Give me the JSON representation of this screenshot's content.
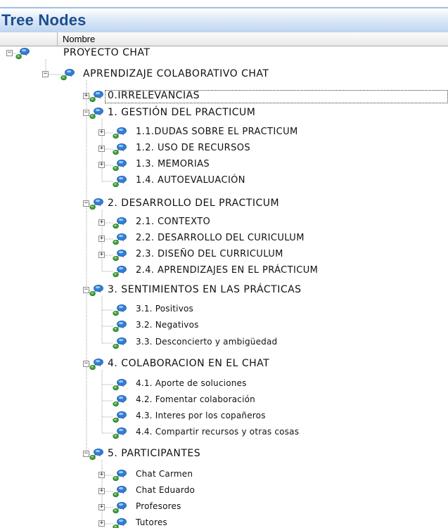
{
  "panel": {
    "title": "Tree Nodes",
    "column_header": "Nombre"
  },
  "icons": {
    "node": "node-network-icon",
    "expanded": "minus-toggle",
    "collapsed": "plus-toggle"
  },
  "colors": {
    "title": "#1c4e8c",
    "icon_blue": "#2f7fd6",
    "icon_green": "#3fa23c"
  },
  "tree": [
    {
      "label": "PROYECTO CHAT",
      "depth": 0,
      "toggle": "expanded"
    },
    {
      "label": "APRENDIZAJE COLABORATIVO CHAT",
      "depth": 1,
      "toggle": "expanded"
    },
    {
      "label": "0.IRRELEVANCIAS",
      "depth": 2,
      "toggle": "collapsed",
      "focused": true
    },
    {
      "label": "1. GESTIÓN DEL PRACTICUM",
      "depth": 2,
      "toggle": "expanded"
    },
    {
      "label": "1.1.DUDAS SOBRE EL PRACTICUM",
      "depth": 3,
      "toggle": "collapsed"
    },
    {
      "label": "1.2. USO DE RECURSOS",
      "depth": 3,
      "toggle": "collapsed"
    },
    {
      "label": "1.3. MEMORIAS",
      "depth": 3,
      "toggle": "collapsed"
    },
    {
      "label": "1.4. AUTOEVALUACIÓN",
      "depth": 3,
      "toggle": "none"
    },
    {
      "label": "2. DESARROLLO DEL PRACTICUM",
      "depth": 2,
      "toggle": "expanded"
    },
    {
      "label": "2.1. CONTEXTO",
      "depth": 3,
      "toggle": "collapsed"
    },
    {
      "label": "2.2. DESARROLLO DEL CURICULUM",
      "depth": 3,
      "toggle": "collapsed"
    },
    {
      "label": "2.3. DISEÑO DEL CURRICULUM",
      "depth": 3,
      "toggle": "collapsed"
    },
    {
      "label": "2.4. APRENDIZAJES EN EL PRÁCTICUM",
      "depth": 3,
      "toggle": "none"
    },
    {
      "label": "3. SENTIMIENTOS EN LAS PRÁCTICAS",
      "depth": 2,
      "toggle": "expanded"
    },
    {
      "label": "3.1. Positivos",
      "depth": 3,
      "toggle": "none"
    },
    {
      "label": "3.2. Negativos",
      "depth": 3,
      "toggle": "none"
    },
    {
      "label": "3.3. Desconcierto y ambigüedad",
      "depth": 3,
      "toggle": "none"
    },
    {
      "label": "4. COLABORACION EN EL CHAT",
      "depth": 2,
      "toggle": "expanded"
    },
    {
      "label": "4.1. Aporte de soluciones",
      "depth": 3,
      "toggle": "none"
    },
    {
      "label": "4.2. Fomentar colaboración",
      "depth": 3,
      "toggle": "none"
    },
    {
      "label": "4.3. Interes por los copañeros",
      "depth": 3,
      "toggle": "none"
    },
    {
      "label": "4.4. Compartir recursos y otras cosas",
      "depth": 3,
      "toggle": "none"
    },
    {
      "label": "5. PARTICIPANTES",
      "depth": 2,
      "toggle": "expanded"
    },
    {
      "label": "Chat Carmen",
      "depth": 3,
      "toggle": "collapsed"
    },
    {
      "label": "Chat Eduardo",
      "depth": 3,
      "toggle": "collapsed"
    },
    {
      "label": "Profesores",
      "depth": 3,
      "toggle": "collapsed"
    },
    {
      "label": "Tutores",
      "depth": 3,
      "toggle": "collapsed"
    }
  ]
}
